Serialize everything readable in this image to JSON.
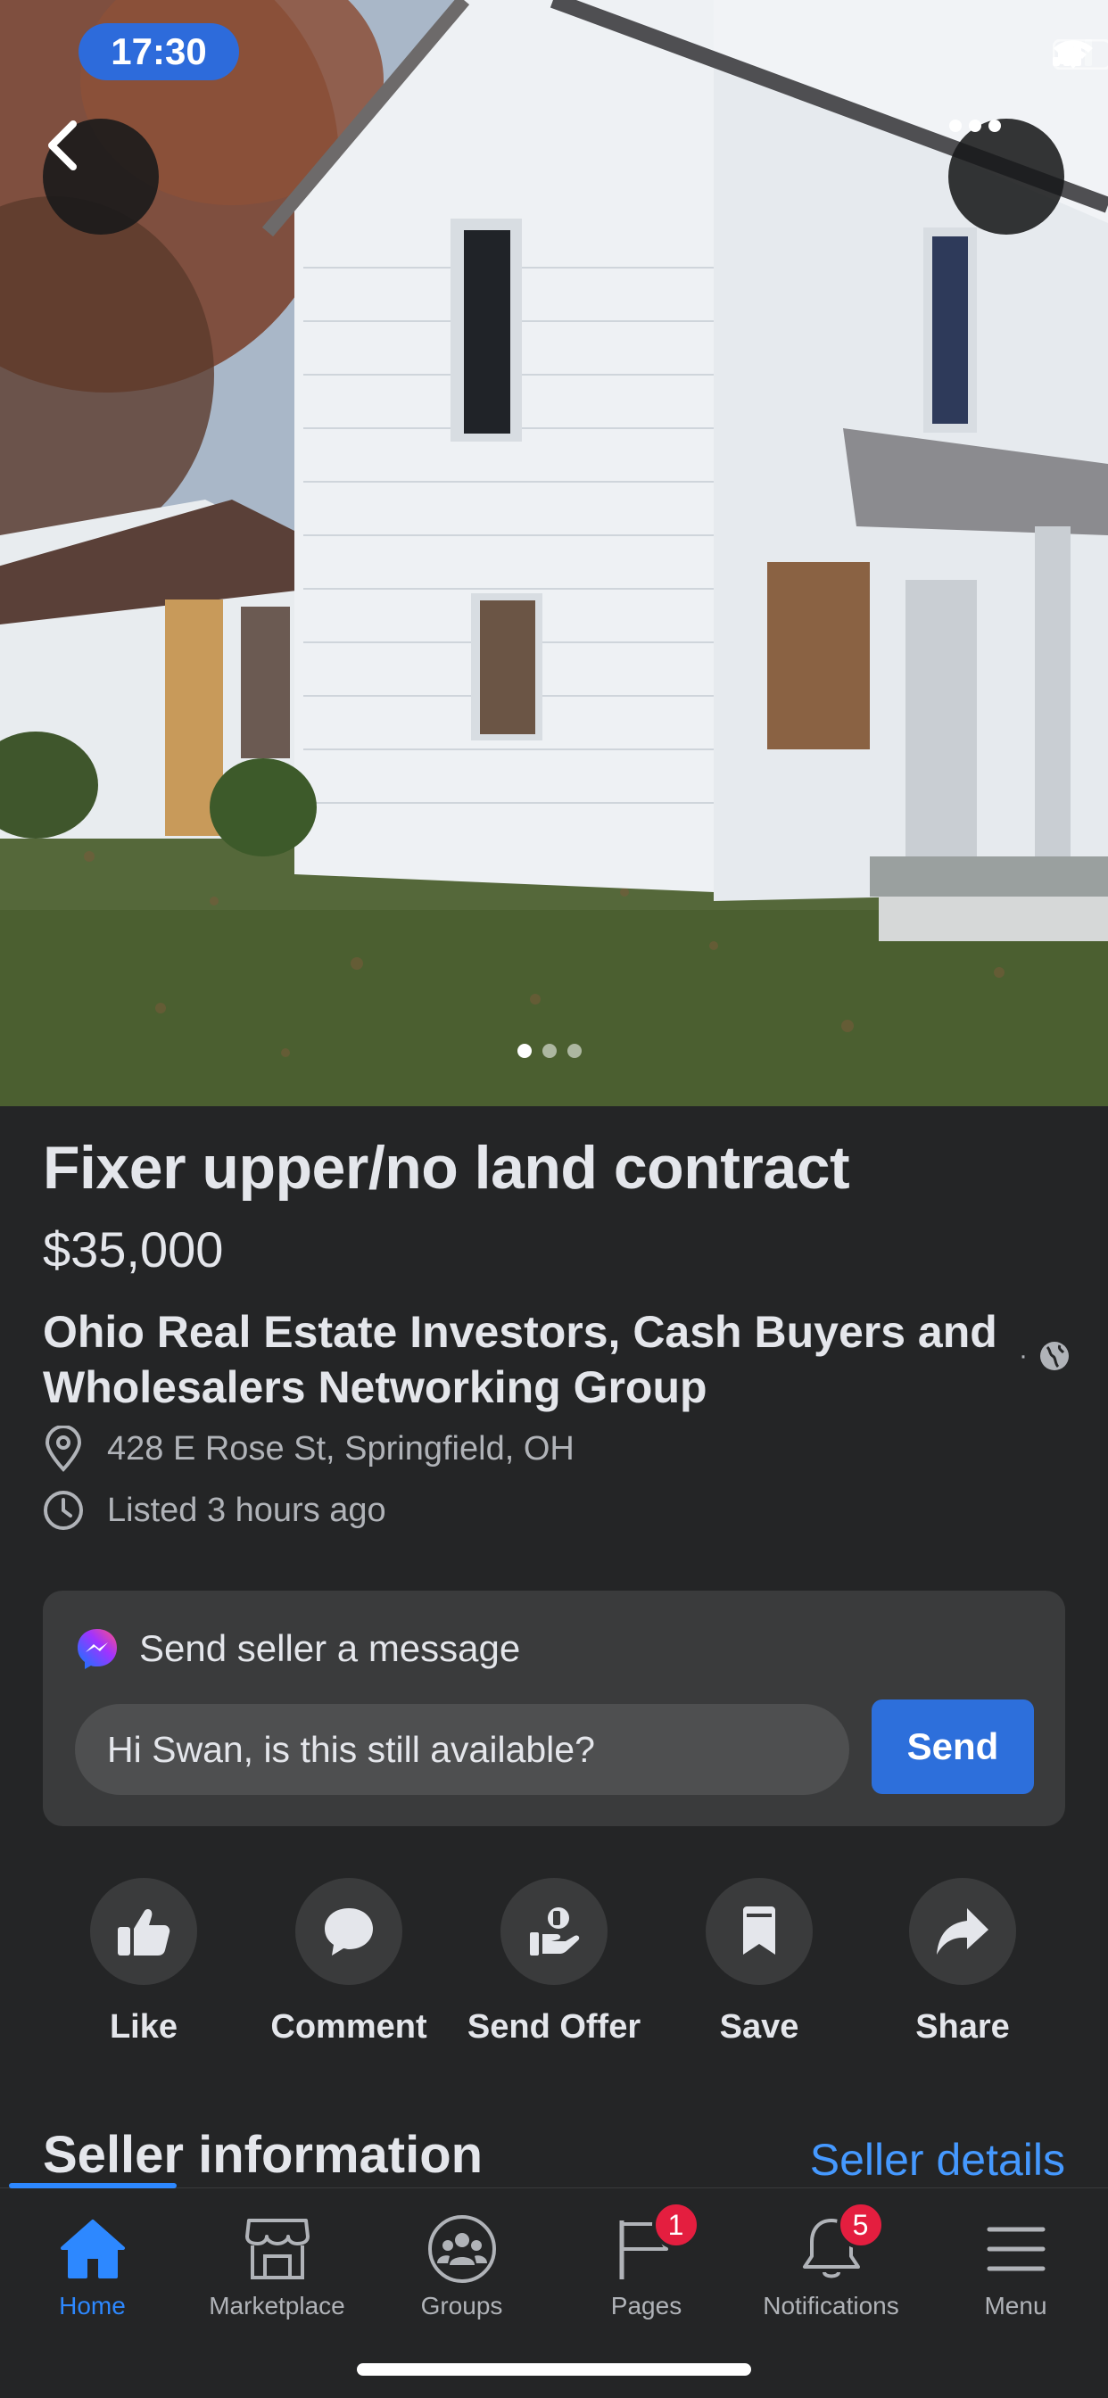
{
  "status_bar": {
    "time": "17:30"
  },
  "listing": {
    "title": "Fixer upper/no land contract",
    "price": "$35,000",
    "group_name": "Ohio Real Estate Investors, Cash Buyers and Wholesalers Networking Group",
    "group_separator": "·",
    "location": "428 E Rose St, Springfield, OH",
    "listed": "Listed 3 hours ago",
    "photo_count": 3,
    "current_photo": 1
  },
  "message": {
    "header": "Send seller a message",
    "input_value": "Hi Swan, is this still available?",
    "send_label": "Send"
  },
  "actions": [
    {
      "label": "Like",
      "icon": "thumbs-up-icon"
    },
    {
      "label": "Comment",
      "icon": "comment-icon"
    },
    {
      "label": "Send Offer",
      "icon": "send-offer-icon"
    },
    {
      "label": "Save",
      "icon": "bookmark-icon"
    },
    {
      "label": "Share",
      "icon": "share-icon"
    }
  ],
  "seller": {
    "title": "Seller information",
    "details_link": "Seller details"
  },
  "tabs": [
    {
      "label": "Home",
      "icon": "home-icon",
      "active": true
    },
    {
      "label": "Marketplace",
      "icon": "marketplace-icon"
    },
    {
      "label": "Groups",
      "icon": "groups-icon"
    },
    {
      "label": "Pages",
      "icon": "pages-flag-icon",
      "badge": "1"
    },
    {
      "label": "Notifications",
      "icon": "bell-icon",
      "badge": "5"
    },
    {
      "label": "Menu",
      "icon": "menu-icon"
    }
  ],
  "colors": {
    "accent": "#2d88ff",
    "send_button": "#2d6fdb",
    "badge": "#e41e3f",
    "background": "#242526",
    "card": "#3a3b3c"
  }
}
